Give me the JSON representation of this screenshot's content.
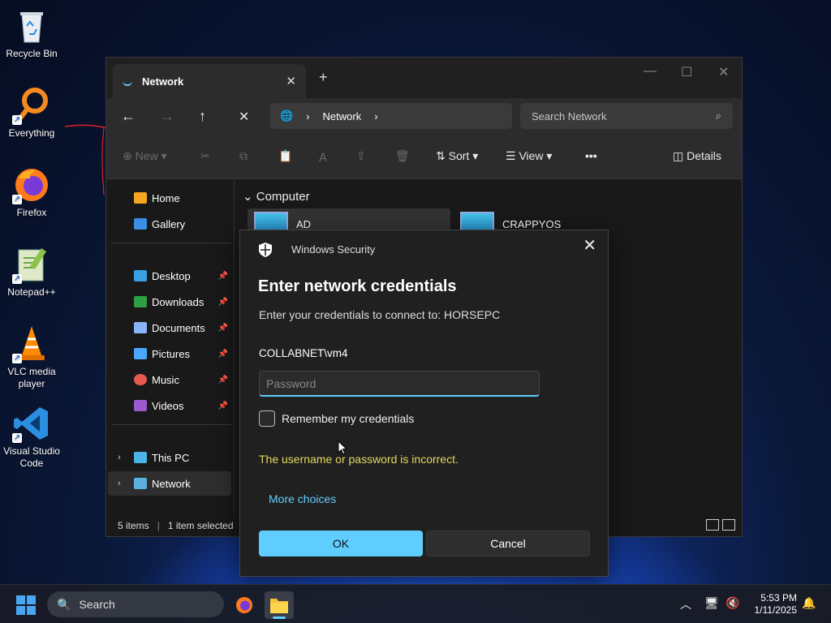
{
  "desktop": {
    "icons": [
      {
        "label": "Recycle Bin"
      },
      {
        "label": "Everything"
      },
      {
        "label": "Firefox"
      },
      {
        "label": "Notepad++"
      },
      {
        "label": "VLC media player"
      },
      {
        "label": "Visual Studio Code"
      }
    ]
  },
  "explorer": {
    "tab_title": "Network",
    "address_segments": [
      "Network"
    ],
    "search_placeholder": "Search Network",
    "toolbar": {
      "new_label": "New",
      "sort_label": "Sort",
      "view_label": "View",
      "more_label": "•••",
      "details_label": "Details"
    },
    "sidebar": {
      "items": [
        {
          "label": "Home"
        },
        {
          "label": "Gallery"
        },
        {
          "label": "Desktop"
        },
        {
          "label": "Downloads"
        },
        {
          "label": "Documents"
        },
        {
          "label": "Pictures"
        },
        {
          "label": "Music"
        },
        {
          "label": "Videos"
        },
        {
          "label": "This PC"
        },
        {
          "label": "Network"
        }
      ]
    },
    "group_header": "Computer",
    "computers": [
      {
        "name": "AD"
      },
      {
        "name": "CRAPPYOS"
      }
    ],
    "status": {
      "items": "5 items",
      "selected": "1 item selected"
    }
  },
  "dialog": {
    "app_name": "Windows Security",
    "title": "Enter network credentials",
    "subtitle": "Enter your credentials to connect to: HORSEPC",
    "username": "COLLABNET\\vm4",
    "password_placeholder": "Password",
    "remember_label": "Remember my credentials",
    "error_message": "The username or password is incorrect.",
    "more_choices": "More choices",
    "ok_label": "OK",
    "cancel_label": "Cancel"
  },
  "taskbar": {
    "search_label": "Search",
    "time": "5:53 PM",
    "date": "1/11/2025"
  },
  "colors": {
    "accent": "#60cdff",
    "error": "#e4d860"
  }
}
